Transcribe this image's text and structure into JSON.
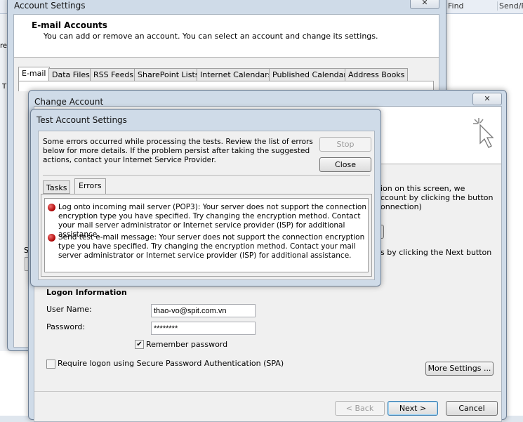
{
  "background": {
    "ribbon_items": [
      "Find",
      "Send/R"
    ],
    "left_fragments": [
      "res",
      "T"
    ]
  },
  "account_settings": {
    "title": "Account Settings",
    "header": "E-mail Accounts",
    "description": "You can add or remove an account. You can select an account and change its settings.",
    "tabs": [
      "E-mail",
      "Data Files",
      "RSS Feeds",
      "SharePoint Lists",
      "Internet Calendars",
      "Published Calendars",
      "Address Books"
    ],
    "active_tab": "E-mail",
    "left_fragment": "S"
  },
  "change_account": {
    "title": "Change Account",
    "right_fragments": [
      "ion on this screen, we",
      "ccount by clicking the button",
      "onnection)",
      "s by clicking the Next button"
    ],
    "logon_heading": "Logon Information",
    "user_name_label": "User Name:",
    "user_name_value": "thao-vo@spit.com.vn",
    "password_label": "Password:",
    "password_value": "********",
    "remember_password_label": "Remember password",
    "remember_password_checked": true,
    "spa_label": "Require logon using Secure Password Authentication (SPA)",
    "spa_checked": false,
    "more_settings": "More Settings ...",
    "back": "< Back",
    "next": "Next >",
    "cancel": "Cancel"
  },
  "test_settings": {
    "title": "Test Account Settings",
    "message": "Some errors occurred while processing the tests. Review the list of errors below for more details. If the problem persist after taking the suggested actions, contact your Internet Service Provider.",
    "stop": "Stop",
    "close": "Close",
    "tabs": [
      "Tasks",
      "Errors"
    ],
    "active_tab": "Errors",
    "errors": [
      "Log onto incoming mail server (POP3): Your server does not support the connection encryption type you have specified. Try changing the encryption method. Contact your mail server administrator or Internet service provider (ISP) for additional assistance.",
      "Send test e-mail message: Your server does not support the connection encryption type you have specified. Try changing the encryption method. Contact your mail server administrator or Internet service provider (ISP) for additional assistance."
    ]
  }
}
